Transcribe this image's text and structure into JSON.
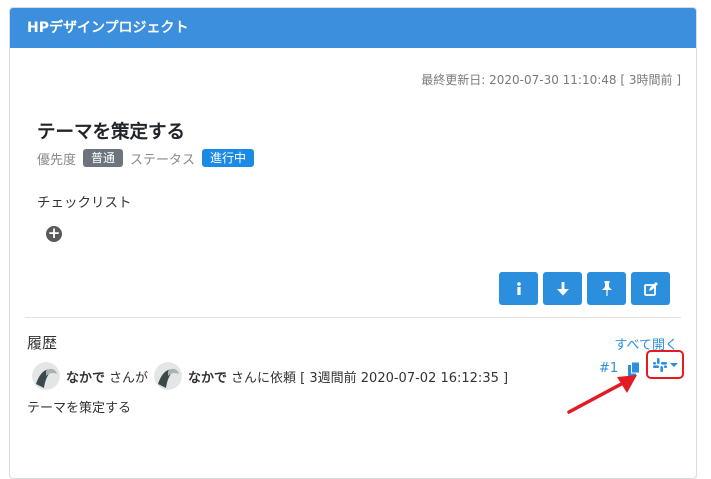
{
  "project": {
    "title": "HPデザインプロジェクト"
  },
  "task": {
    "updated": "最終更新日: 2020-07-30 11:10:48 [ 3時間前 ]",
    "title": "テーマを策定する",
    "priority_label": "優先度",
    "priority_value": "普通",
    "status_label": "ステータス",
    "status_value": "進行中",
    "checklist_label": "チェックリスト"
  },
  "toolbar": {
    "buttons": [
      "info-icon",
      "arrow-down-icon",
      "pin-icon",
      "edit-icon"
    ]
  },
  "history": {
    "title": "履歴",
    "open_all": "すべて開く",
    "entries": [
      {
        "from_user": "なかで",
        "from_suffix": "さんが",
        "to_user": "なかで",
        "to_suffix": "さんに依頼 [ 3週間前 2020-07-02 16:12:35 ]",
        "number": "#1",
        "text": "テーマを策定する"
      }
    ]
  },
  "colors": {
    "header": "#3b8fdd",
    "primary": "#2c8fdd",
    "badge_gray": "#6c757d",
    "badge_blue": "#1a8ae5",
    "highlight": "#e31b23"
  }
}
